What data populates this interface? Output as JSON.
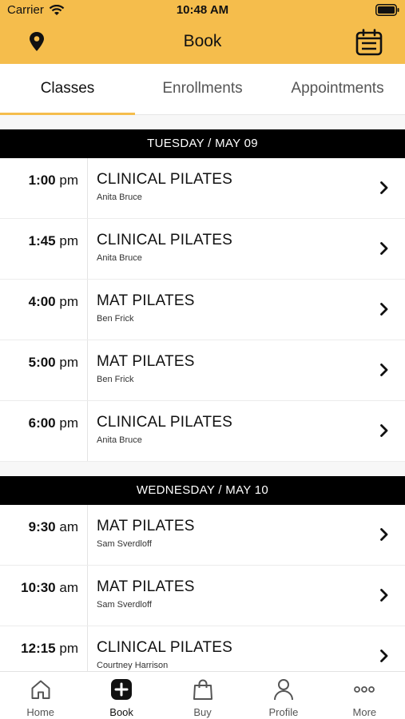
{
  "status": {
    "carrier": "Carrier",
    "time": "10:48 AM"
  },
  "header": {
    "title": "Book",
    "location_icon": "location-pin-icon",
    "calendar_icon": "calendar-icon"
  },
  "tabs": [
    {
      "label": "Classes",
      "active": true
    },
    {
      "label": "Enrollments",
      "active": false
    },
    {
      "label": "Appointments",
      "active": false
    }
  ],
  "days": [
    {
      "header": "TUESDAY / MAY 09",
      "classes": [
        {
          "time": "1:00",
          "ampm": "pm",
          "name": "CLINICAL PILATES",
          "instructor": "Anita Bruce"
        },
        {
          "time": "1:45",
          "ampm": "pm",
          "name": "CLINICAL PILATES",
          "instructor": "Anita Bruce"
        },
        {
          "time": "4:00",
          "ampm": "pm",
          "name": "MAT PILATES",
          "instructor": "Ben Frick"
        },
        {
          "time": "5:00",
          "ampm": "pm",
          "name": "MAT PILATES",
          "instructor": "Ben Frick"
        },
        {
          "time": "6:00",
          "ampm": "pm",
          "name": "CLINICAL PILATES",
          "instructor": "Anita Bruce"
        }
      ]
    },
    {
      "header": "WEDNESDAY / MAY 10",
      "classes": [
        {
          "time": "9:30",
          "ampm": "am",
          "name": "MAT PILATES",
          "instructor": "Sam Sverdloff"
        },
        {
          "time": "10:30",
          "ampm": "am",
          "name": "MAT PILATES",
          "instructor": "Sam Sverdloff"
        },
        {
          "time": "12:15",
          "ampm": "pm",
          "name": "CLINICAL PILATES",
          "instructor": "Courtney Harrison"
        }
      ]
    }
  ],
  "bottom_nav": [
    {
      "label": "Home",
      "icon": "home-icon",
      "active": false
    },
    {
      "label": "Book",
      "icon": "plus-square-icon",
      "active": true
    },
    {
      "label": "Buy",
      "icon": "shopping-bag-icon",
      "active": false
    },
    {
      "label": "Profile",
      "icon": "person-icon",
      "active": false
    },
    {
      "label": "More",
      "icon": "more-dots-icon",
      "active": false
    }
  ],
  "colors": {
    "accent": "#f5bd4c",
    "day_header_bg": "#000000"
  }
}
